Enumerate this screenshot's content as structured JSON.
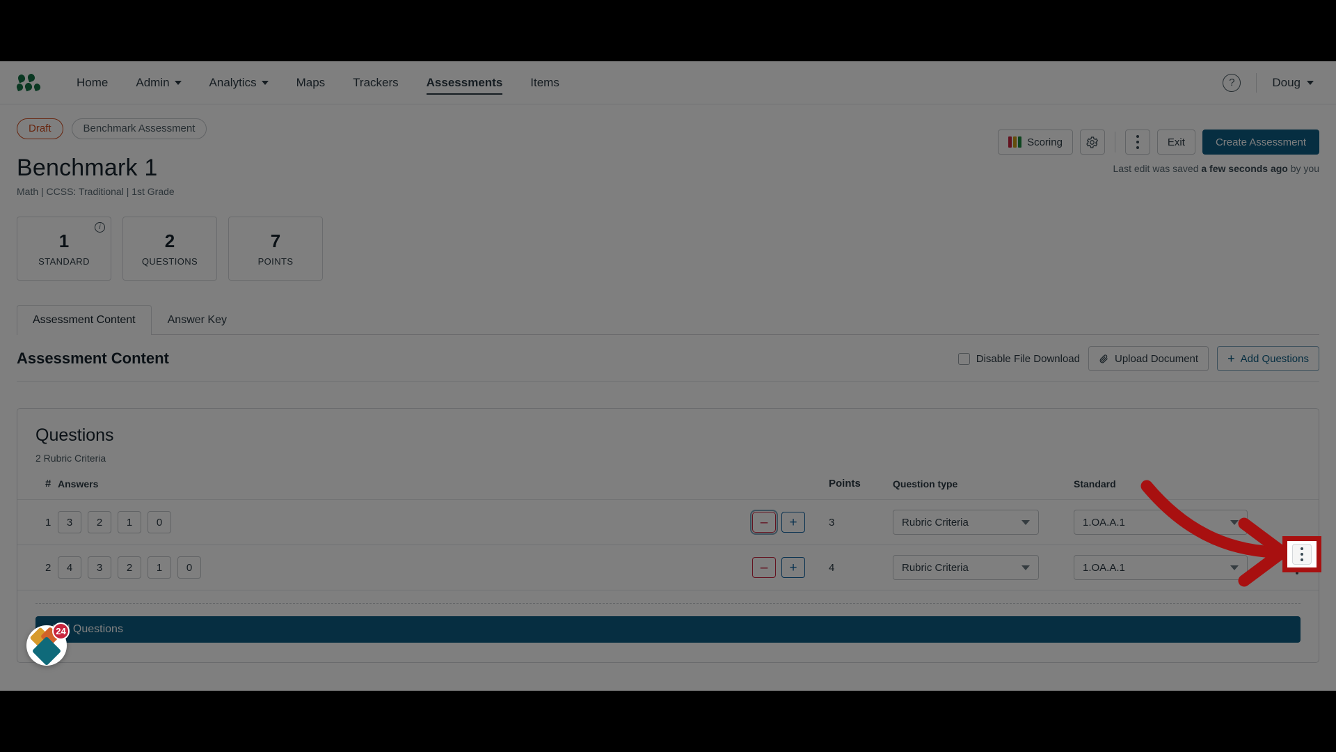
{
  "nav": {
    "logo_name": "company-logo",
    "items": [
      {
        "label": "Home",
        "dropdown": false,
        "active": false
      },
      {
        "label": "Admin",
        "dropdown": true,
        "active": false
      },
      {
        "label": "Analytics",
        "dropdown": true,
        "active": false
      },
      {
        "label": "Maps",
        "dropdown": false,
        "active": false
      },
      {
        "label": "Trackers",
        "dropdown": false,
        "active": false
      },
      {
        "label": "Assessments",
        "dropdown": false,
        "active": true
      },
      {
        "label": "Items",
        "dropdown": false,
        "active": false
      }
    ],
    "help_glyph": "?",
    "user_label": "Doug"
  },
  "header": {
    "status_pill": "Draft",
    "type_pill": "Benchmark Assessment",
    "title": "Benchmark 1",
    "subtitle": "Math  |  CCSS: Traditional  |  1st Grade",
    "saved_prefix": "Last edit was saved ",
    "saved_strong": "a few seconds ago",
    "saved_suffix": " by you"
  },
  "actions": {
    "scoring_label": "Scoring",
    "settings_icon": "gear-icon",
    "more_icon": "kebab-icon",
    "exit_label": "Exit",
    "create_label": "Create Assessment",
    "scoring_colors": [
      "#c7253e",
      "#c89a16",
      "#1d8a3f"
    ]
  },
  "stats": [
    {
      "value": "1",
      "label": "STANDARD",
      "has_info": true
    },
    {
      "value": "2",
      "label": "QUESTIONS",
      "has_info": false
    },
    {
      "value": "7",
      "label": "POINTS",
      "has_info": false
    }
  ],
  "tabs": [
    {
      "label": "Assessment Content",
      "active": true
    },
    {
      "label": "Answer Key",
      "active": false
    }
  ],
  "section": {
    "heading": "Assessment Content",
    "disable_download_label": "Disable File Download",
    "disable_download_checked": false,
    "upload_label": "Upload Document",
    "upload_icon": "paperclip-icon",
    "add_questions_label": "Add Questions",
    "add_questions_icon": "plus-icon"
  },
  "questions_panel": {
    "title": "Questions",
    "subtitle": "2 Rubric Criteria",
    "columns": [
      "#",
      "Answers",
      "",
      "Points",
      "Question type",
      "Standard",
      ""
    ],
    "rows": [
      {
        "num": "1",
        "answers": [
          "3",
          "2",
          "1",
          "0"
        ],
        "minus": "–",
        "plus": "+",
        "minus_focused": true,
        "points": "3",
        "question_type": "Rubric Criteria",
        "standard": "1.OA.A.1",
        "kebab_highlighted": true
      },
      {
        "num": "2",
        "answers": [
          "4",
          "3",
          "2",
          "1",
          "0"
        ],
        "minus": "–",
        "plus": "+",
        "minus_focused": false,
        "points": "4",
        "question_type": "Rubric Criteria",
        "standard": "1.OA.A.1",
        "kebab_highlighted": false
      }
    ],
    "footer_button": "Add Questions"
  },
  "help_widget": {
    "badge_count": "24",
    "name": "help-launcher"
  },
  "annotation": {
    "arrow_color": "#a81010",
    "highlight_color": "#a81010"
  }
}
